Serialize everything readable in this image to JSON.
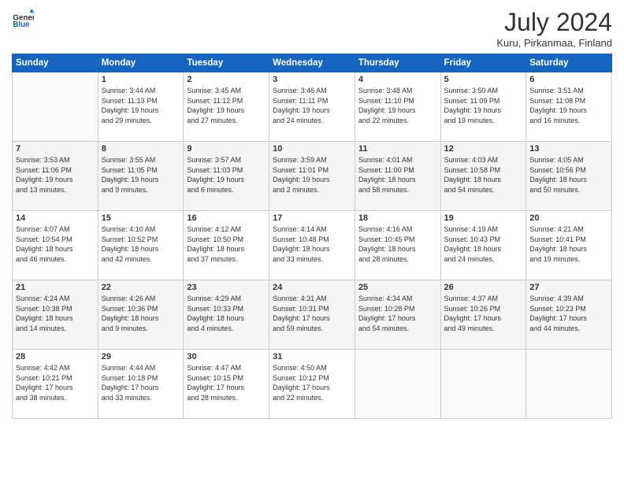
{
  "header": {
    "logo_general": "General",
    "logo_blue": "Blue",
    "month_year": "July 2024",
    "location": "Kuru, Pirkanmaa, Finland"
  },
  "days_of_week": [
    "Sunday",
    "Monday",
    "Tuesday",
    "Wednesday",
    "Thursday",
    "Friday",
    "Saturday"
  ],
  "weeks": [
    [
      {
        "day": "",
        "info": ""
      },
      {
        "day": "1",
        "info": "Sunrise: 3:44 AM\nSunset: 11:13 PM\nDaylight: 19 hours\nand 29 minutes."
      },
      {
        "day": "2",
        "info": "Sunrise: 3:45 AM\nSunset: 11:12 PM\nDaylight: 19 hours\nand 27 minutes."
      },
      {
        "day": "3",
        "info": "Sunrise: 3:46 AM\nSunset: 11:11 PM\nDaylight: 19 hours\nand 24 minutes."
      },
      {
        "day": "4",
        "info": "Sunrise: 3:48 AM\nSunset: 11:10 PM\nDaylight: 19 hours\nand 22 minutes."
      },
      {
        "day": "5",
        "info": "Sunrise: 3:50 AM\nSunset: 11:09 PM\nDaylight: 19 hours\nand 19 minutes."
      },
      {
        "day": "6",
        "info": "Sunrise: 3:51 AM\nSunset: 11:08 PM\nDaylight: 19 hours\nand 16 minutes."
      }
    ],
    [
      {
        "day": "7",
        "info": "Sunrise: 3:53 AM\nSunset: 11:06 PM\nDaylight: 19 hours\nand 13 minutes."
      },
      {
        "day": "8",
        "info": "Sunrise: 3:55 AM\nSunset: 11:05 PM\nDaylight: 19 hours\nand 9 minutes."
      },
      {
        "day": "9",
        "info": "Sunrise: 3:57 AM\nSunset: 11:03 PM\nDaylight: 19 hours\nand 6 minutes."
      },
      {
        "day": "10",
        "info": "Sunrise: 3:59 AM\nSunset: 11:01 PM\nDaylight: 19 hours\nand 2 minutes."
      },
      {
        "day": "11",
        "info": "Sunrise: 4:01 AM\nSunset: 11:00 PM\nDaylight: 18 hours\nand 58 minutes."
      },
      {
        "day": "12",
        "info": "Sunrise: 4:03 AM\nSunset: 10:58 PM\nDaylight: 18 hours\nand 54 minutes."
      },
      {
        "day": "13",
        "info": "Sunrise: 4:05 AM\nSunset: 10:56 PM\nDaylight: 18 hours\nand 50 minutes."
      }
    ],
    [
      {
        "day": "14",
        "info": "Sunrise: 4:07 AM\nSunset: 10:54 PM\nDaylight: 18 hours\nand 46 minutes."
      },
      {
        "day": "15",
        "info": "Sunrise: 4:10 AM\nSunset: 10:52 PM\nDaylight: 18 hours\nand 42 minutes."
      },
      {
        "day": "16",
        "info": "Sunrise: 4:12 AM\nSunset: 10:50 PM\nDaylight: 18 hours\nand 37 minutes."
      },
      {
        "day": "17",
        "info": "Sunrise: 4:14 AM\nSunset: 10:48 PM\nDaylight: 18 hours\nand 33 minutes."
      },
      {
        "day": "18",
        "info": "Sunrise: 4:16 AM\nSunset: 10:45 PM\nDaylight: 18 hours\nand 28 minutes."
      },
      {
        "day": "19",
        "info": "Sunrise: 4:19 AM\nSunset: 10:43 PM\nDaylight: 18 hours\nand 24 minutes."
      },
      {
        "day": "20",
        "info": "Sunrise: 4:21 AM\nSunset: 10:41 PM\nDaylight: 18 hours\nand 19 minutes."
      }
    ],
    [
      {
        "day": "21",
        "info": "Sunrise: 4:24 AM\nSunset: 10:38 PM\nDaylight: 18 hours\nand 14 minutes."
      },
      {
        "day": "22",
        "info": "Sunrise: 4:26 AM\nSunset: 10:36 PM\nDaylight: 18 hours\nand 9 minutes."
      },
      {
        "day": "23",
        "info": "Sunrise: 4:29 AM\nSunset: 10:33 PM\nDaylight: 18 hours\nand 4 minutes."
      },
      {
        "day": "24",
        "info": "Sunrise: 4:31 AM\nSunset: 10:31 PM\nDaylight: 17 hours\nand 59 minutes."
      },
      {
        "day": "25",
        "info": "Sunrise: 4:34 AM\nSunset: 10:28 PM\nDaylight: 17 hours\nand 54 minutes."
      },
      {
        "day": "26",
        "info": "Sunrise: 4:37 AM\nSunset: 10:26 PM\nDaylight: 17 hours\nand 49 minutes."
      },
      {
        "day": "27",
        "info": "Sunrise: 4:39 AM\nSunset: 10:23 PM\nDaylight: 17 hours\nand 44 minutes."
      }
    ],
    [
      {
        "day": "28",
        "info": "Sunrise: 4:42 AM\nSunset: 10:21 PM\nDaylight: 17 hours\nand 38 minutes."
      },
      {
        "day": "29",
        "info": "Sunrise: 4:44 AM\nSunset: 10:18 PM\nDaylight: 17 hours\nand 33 minutes."
      },
      {
        "day": "30",
        "info": "Sunrise: 4:47 AM\nSunset: 10:15 PM\nDaylight: 17 hours\nand 28 minutes."
      },
      {
        "day": "31",
        "info": "Sunrise: 4:50 AM\nSunset: 10:12 PM\nDaylight: 17 hours\nand 22 minutes."
      },
      {
        "day": "",
        "info": ""
      },
      {
        "day": "",
        "info": ""
      },
      {
        "day": "",
        "info": ""
      }
    ]
  ]
}
